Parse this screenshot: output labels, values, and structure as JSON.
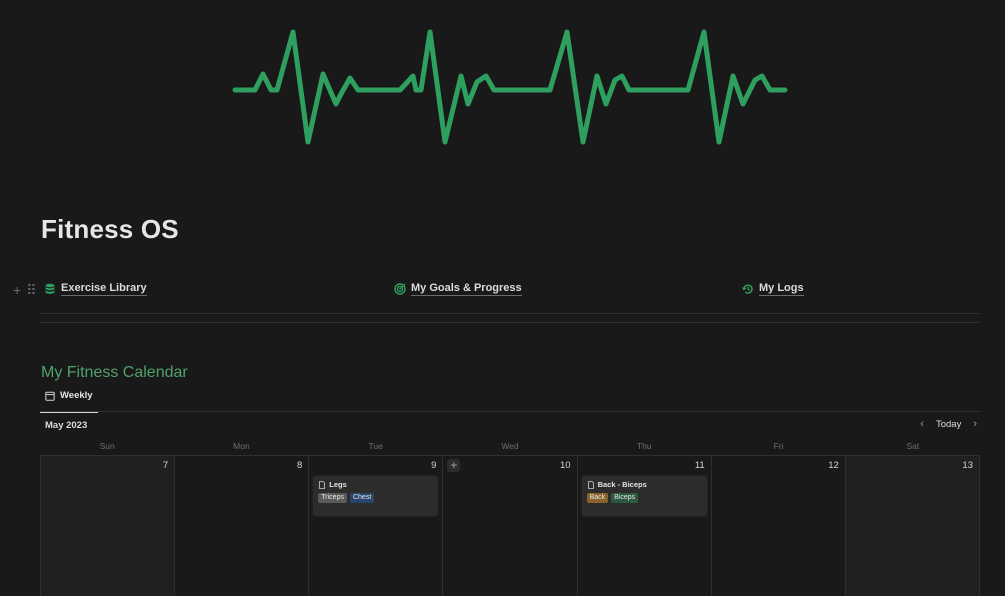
{
  "page": {
    "title": "Fitness OS",
    "accent": "#2e9f5e"
  },
  "links": [
    {
      "label": "Exercise Library",
      "icon": "database-icon"
    },
    {
      "label": "My Goals & Progress",
      "icon": "target-icon"
    },
    {
      "label": "My Logs",
      "icon": "history-icon"
    }
  ],
  "calendar": {
    "title": "My Fitness Calendar",
    "view_tab": "Weekly",
    "month": "May 2023",
    "today_label": "Today",
    "weekdays": [
      "Sun",
      "Mon",
      "Tue",
      "Wed",
      "Thu",
      "Fri",
      "Sat"
    ],
    "days": [
      "7",
      "8",
      "9",
      "10",
      "11",
      "12",
      "13"
    ],
    "events": [
      {
        "title": "Legs",
        "day": "9",
        "tags": [
          {
            "label": "Triceps",
            "color": "#5a5a5a"
          },
          {
            "label": "Chest",
            "color": "#28456c"
          }
        ]
      },
      {
        "title": "Back - Biceps",
        "day": "11",
        "tags": [
          {
            "label": "Back",
            "color": "#89632a"
          },
          {
            "label": "Biceps",
            "color": "#2b593f"
          }
        ]
      }
    ]
  }
}
